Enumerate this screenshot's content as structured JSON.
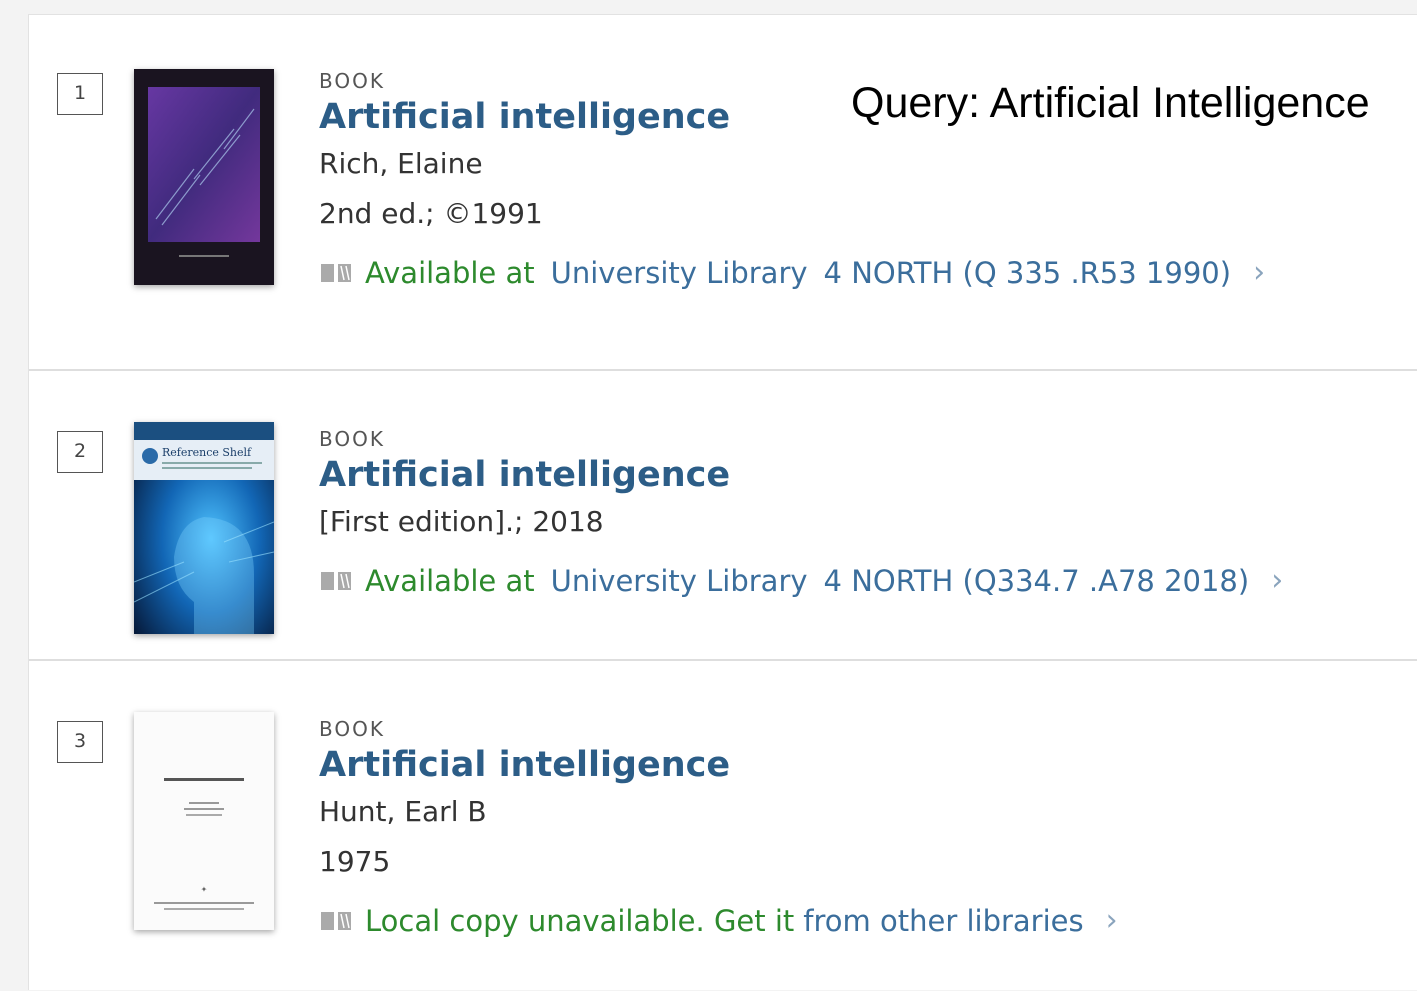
{
  "query_note": "Query: Artificial Intelligence",
  "results": [
    {
      "number": "1",
      "type": "BOOK",
      "title": "Artificial intelligence",
      "author": "Rich, Elaine",
      "edition": "2nd ed.; ©1991",
      "availability": {
        "status": "Available at",
        "library": "University Library",
        "location": "4 NORTH (Q 335 .R53 1990)"
      }
    },
    {
      "number": "2",
      "type": "BOOK",
      "title": "Artificial intelligence",
      "edition": "[First edition].; 2018",
      "availability": {
        "status": "Available at",
        "library": "University Library",
        "location": "4 NORTH (Q334.7 .A78 2018)"
      }
    },
    {
      "number": "3",
      "type": "BOOK",
      "title": "Artificial intelligence",
      "author": "Hunt, Earl B",
      "edition": "1975",
      "availability": {
        "status": "Local copy unavailable. Get it",
        "link": "from other libraries"
      }
    }
  ],
  "covers": {
    "r2_series_label": "Reference Shelf"
  },
  "colors": {
    "title": "#2c5d87",
    "available": "#2d8a2d",
    "link": "#3b6e9c"
  },
  "icons": {
    "availability": "book-icon",
    "chevron": "chevron-right-icon"
  }
}
